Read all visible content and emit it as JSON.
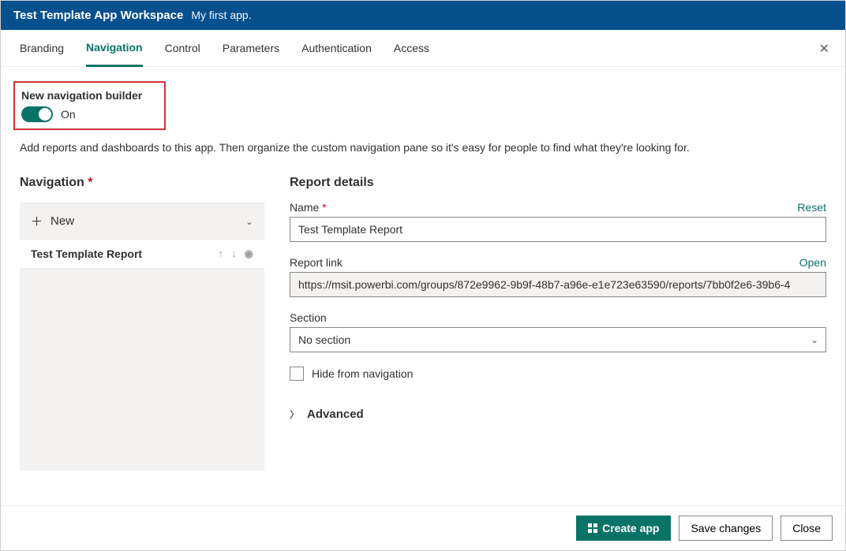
{
  "header": {
    "workspace_name": "Test Template App Workspace",
    "subtitle": "My first app."
  },
  "tabs": {
    "items": [
      {
        "label": "Branding",
        "active": false
      },
      {
        "label": "Navigation",
        "active": true
      },
      {
        "label": "Control",
        "active": false
      },
      {
        "label": "Parameters",
        "active": false
      },
      {
        "label": "Authentication",
        "active": false
      },
      {
        "label": "Access",
        "active": false
      }
    ]
  },
  "nav_builder": {
    "title": "New navigation builder",
    "state_label": "On"
  },
  "helper_text": "Add reports and dashboards to this app. Then organize the custom navigation pane so it's easy for people to find what they're looking for.",
  "navigation": {
    "title": "Navigation",
    "new_label": "New",
    "items": [
      {
        "name": "Test Template Report"
      }
    ]
  },
  "details": {
    "title": "Report details",
    "name_label": "Name",
    "reset_label": "Reset",
    "name_value": "Test Template Report",
    "link_label": "Report link",
    "open_label": "Open",
    "link_value": "https://msit.powerbi.com/groups/872e9962-9b9f-48b7-a96e-e1e723e63590/reports/7bb0f2e6-39b6-4",
    "section_label": "Section",
    "section_value": "No section",
    "hide_label": "Hide from navigation",
    "advanced_label": "Advanced"
  },
  "footer": {
    "create_label": "Create app",
    "save_label": "Save changes",
    "close_label": "Close"
  }
}
